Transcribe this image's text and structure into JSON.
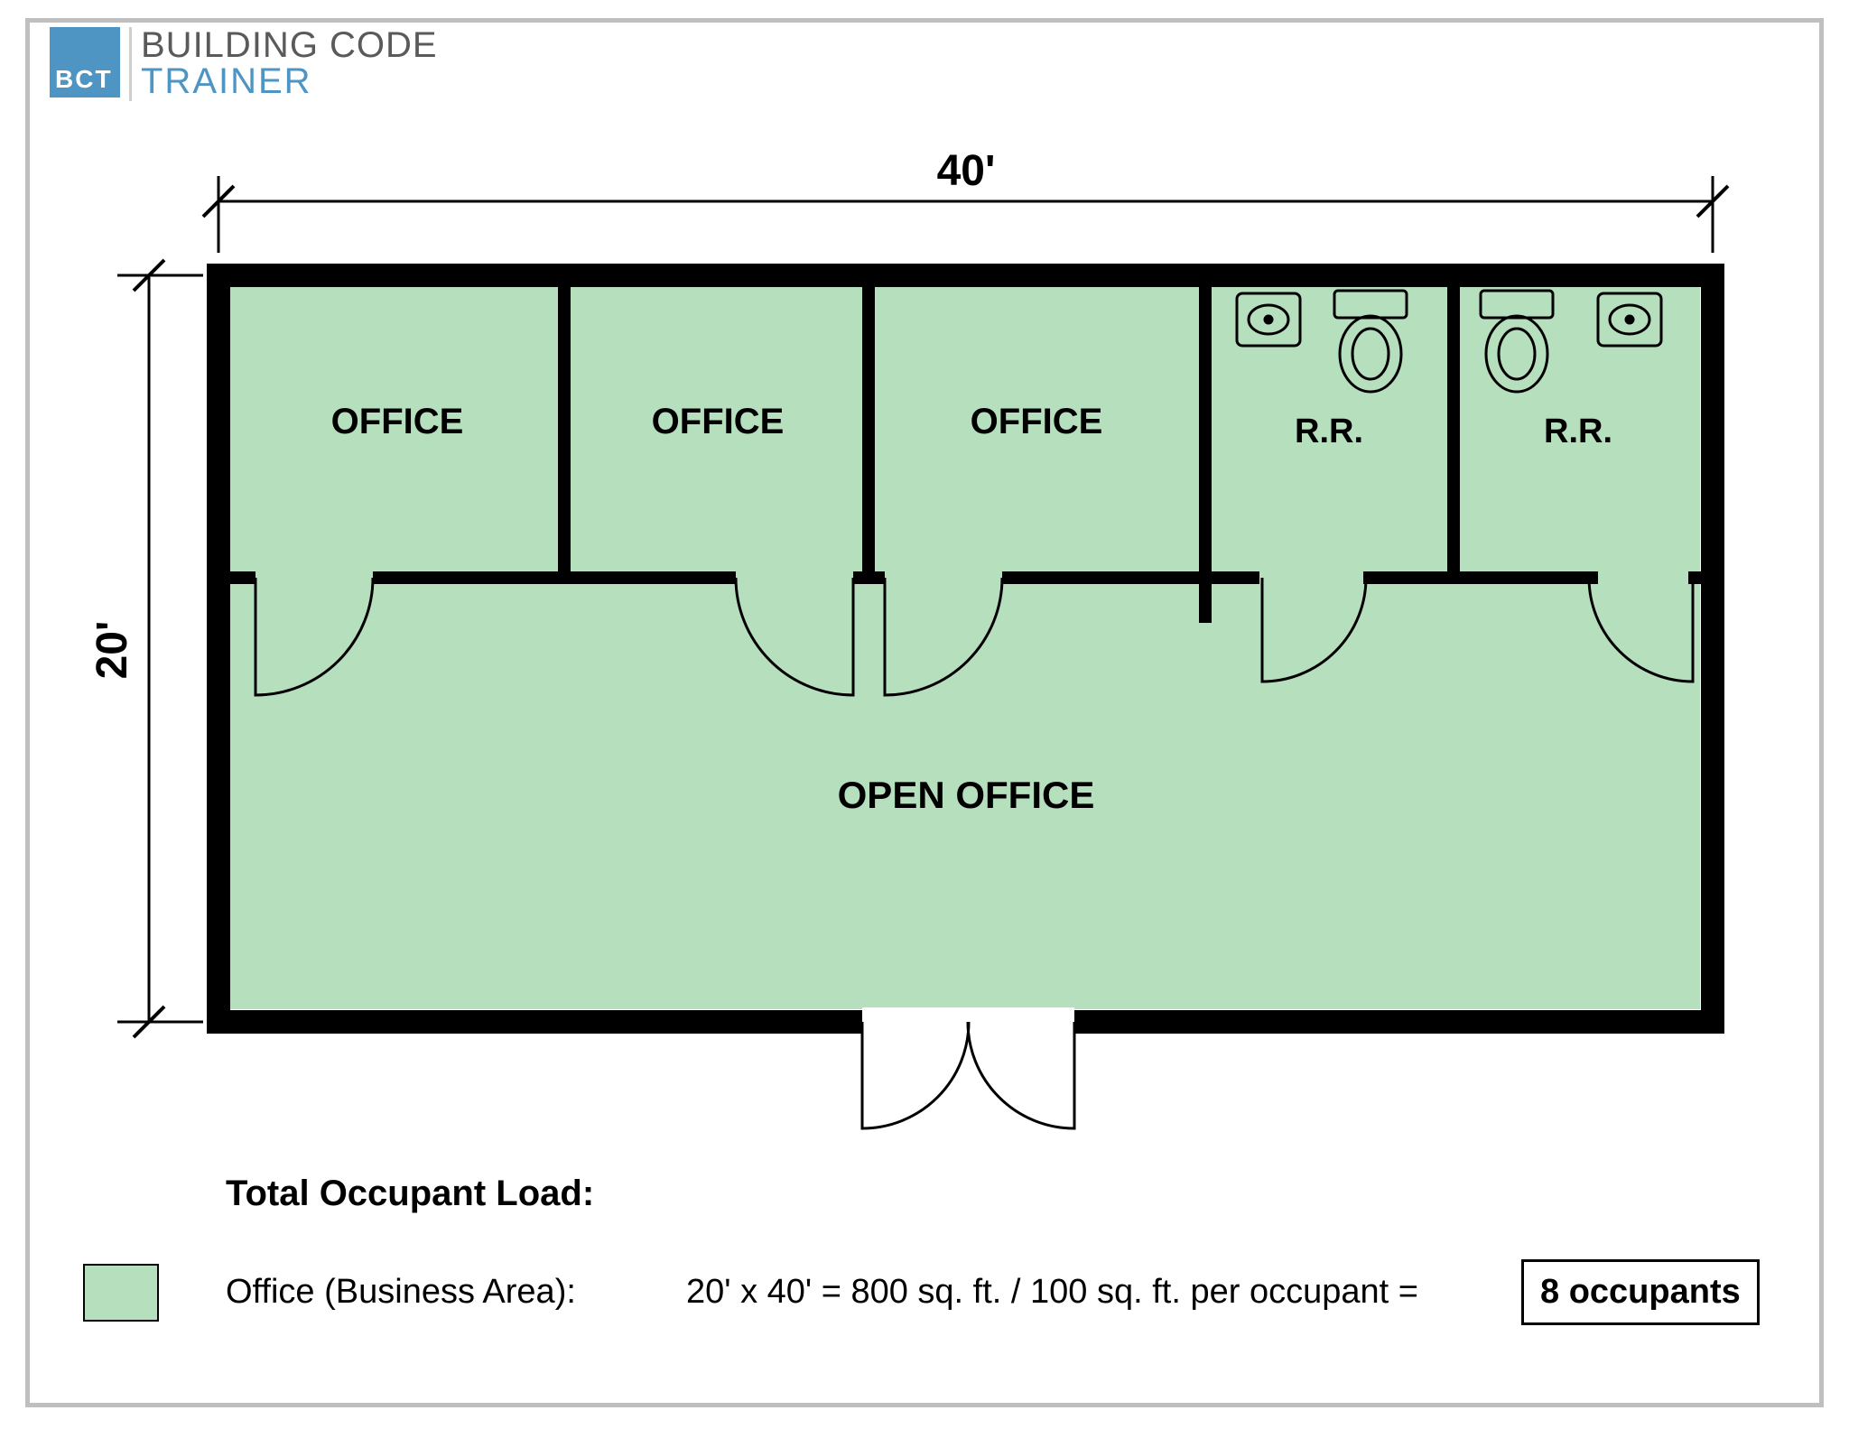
{
  "logo": {
    "mark": "BCT",
    "line1": "BUILDING CODE",
    "line2": "TRAINER"
  },
  "dimensions": {
    "width_label": "40'",
    "height_label": "20'"
  },
  "rooms": {
    "office1": "OFFICE",
    "office2": "OFFICE",
    "office3": "OFFICE",
    "rr1": "R.R.",
    "rr2": "R.R.",
    "open": "OPEN OFFICE"
  },
  "footer": {
    "title": "Total Occupant Load:",
    "swatch_label": "Office (Business Area):",
    "calc_text": "20' x 40' = 800 sq. ft.  /  100 sq. ft. per occupant  =",
    "result": "8 occupants"
  },
  "chart_data": {
    "type": "diagram",
    "floor_plan": {
      "building_width_ft": 40,
      "building_height_ft": 20,
      "rooms": [
        {
          "name": "Office 1",
          "type": "office"
        },
        {
          "name": "Office 2",
          "type": "office"
        },
        {
          "name": "Office 3",
          "type": "office"
        },
        {
          "name": "Restroom 1",
          "type": "restroom",
          "fixtures": [
            "sink",
            "toilet"
          ]
        },
        {
          "name": "Restroom 2",
          "type": "restroom",
          "fixtures": [
            "toilet",
            "sink"
          ]
        },
        {
          "name": "Open Office",
          "type": "open_office"
        }
      ],
      "exterior_door": "bottom-center double swing"
    },
    "occupant_load": {
      "area_sq_ft": 800,
      "factor_sq_ft_per_occupant": 100,
      "occupants": 8,
      "use": "Office (Business Area)"
    }
  }
}
